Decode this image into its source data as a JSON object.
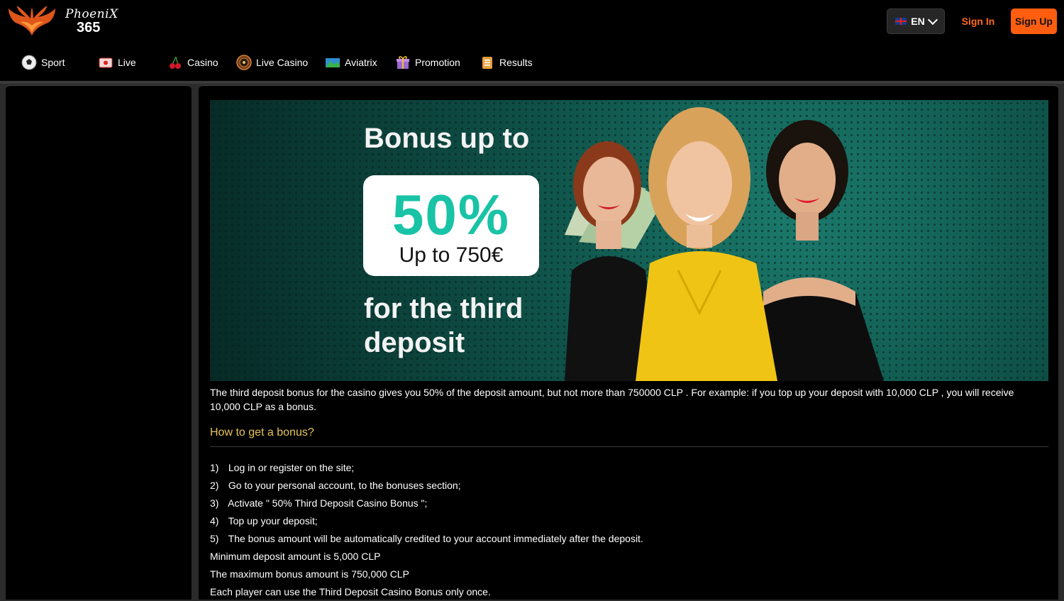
{
  "header": {
    "logo_word": "PhoeniX",
    "logo_number": "365",
    "language": "EN",
    "sign_in": "Sign In",
    "sign_up": "Sign Up"
  },
  "nav": [
    {
      "label": "Sport",
      "icon": "soccer-ball-icon"
    },
    {
      "label": "Live",
      "icon": "live-tv-icon"
    },
    {
      "label": "Casino",
      "icon": "cherries-icon"
    },
    {
      "label": "Live Casino",
      "icon": "roulette-icon"
    },
    {
      "label": "Aviatrix",
      "icon": "aviatrix-icon"
    },
    {
      "label": "Promotion",
      "icon": "gift-icon"
    },
    {
      "label": "Results",
      "icon": "results-clipboard-icon"
    }
  ],
  "banner": {
    "headline": "Bonus up to",
    "percent": "50%",
    "cap": "Up to 750€",
    "footer_line1": "for the third",
    "footer_line2": "deposit"
  },
  "content": {
    "description": "The third deposit bonus for the casino gives you 50% of the deposit amount, but not more than 750000 CLP . For example: if you top up your deposit with 10,000 CLP , you will receive 10,000 CLP as a bonus.",
    "howto_title": "How to get a bonus?",
    "steps": [
      {
        "num": "1)",
        "text": "Log in or register on the site;"
      },
      {
        "num": "2)",
        "text": "Go to your personal account, to the bonuses section;"
      },
      {
        "num": "3)",
        "text": "Activate \" 50% Third Deposit Casino Bonus \";"
      },
      {
        "num": "4)",
        "text": "Top up your deposit;"
      },
      {
        "num": "5)",
        "text": "The bonus amount will be automatically credited to your account immediately after the deposit."
      }
    ],
    "min_deposit": "Minimum deposit amount is 5,000 CLP",
    "max_bonus": "The maximum bonus amount is 750,000 CLP",
    "once_rule": "Each player can use the Third Deposit Casino Bonus only once."
  },
  "colors": {
    "accent": "#ff5e10",
    "howto": "#e6c35a",
    "banner_teal": "#19c3a6"
  }
}
